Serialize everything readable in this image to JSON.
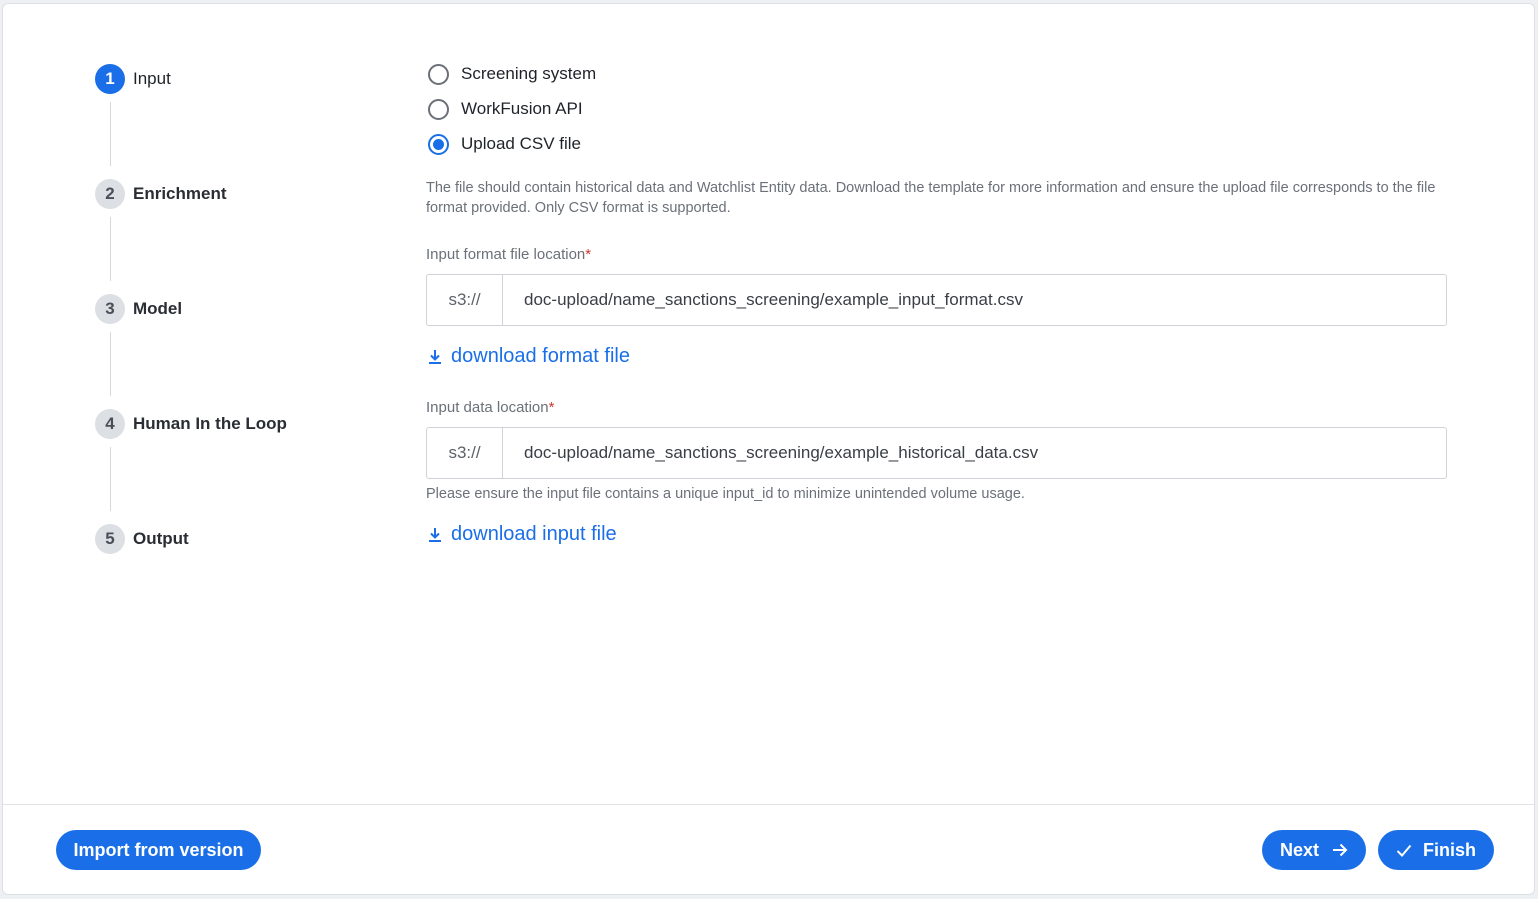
{
  "stepper": {
    "steps": [
      {
        "number": "1",
        "label": "Input",
        "active": true
      },
      {
        "number": "2",
        "label": "Enrichment",
        "active": false
      },
      {
        "number": "3",
        "label": "Model",
        "active": false
      },
      {
        "number": "4",
        "label": "Human In the Loop",
        "active": false
      },
      {
        "number": "5",
        "label": "Output",
        "active": false
      }
    ]
  },
  "source_options": [
    {
      "label": "Screening system",
      "checked": false
    },
    {
      "label": "WorkFusion API",
      "checked": false
    },
    {
      "label": "Upload CSV file",
      "checked": true
    }
  ],
  "upload_help_text": "The file should contain historical data and Watchlist Entity data. Download the template for more information and ensure the upload file corresponds to the file format provided. Only CSV format is supported.",
  "format_field": {
    "label": "Input format file location",
    "required_mark": "*",
    "prefix": "s3://",
    "value": "doc-upload/name_sanctions_screening/example_input_format.csv",
    "download_label": "download format file",
    "download_icon": "download-icon"
  },
  "data_field": {
    "label": "Input data location",
    "required_mark": "*",
    "prefix": "s3://",
    "value": "doc-upload/name_sanctions_screening/example_historical_data.csv",
    "hint": "Please ensure the input file contains a unique input_id to minimize unintended volume usage.",
    "download_label": "download input file",
    "download_icon": "download-icon"
  },
  "footer": {
    "import_label": "Import from version",
    "next_label": "Next",
    "next_icon": "arrow-right-icon",
    "finish_label": "Finish",
    "finish_icon": "check-icon"
  },
  "colors": {
    "accent": "#1a6fe8",
    "required": "#d0342c"
  }
}
